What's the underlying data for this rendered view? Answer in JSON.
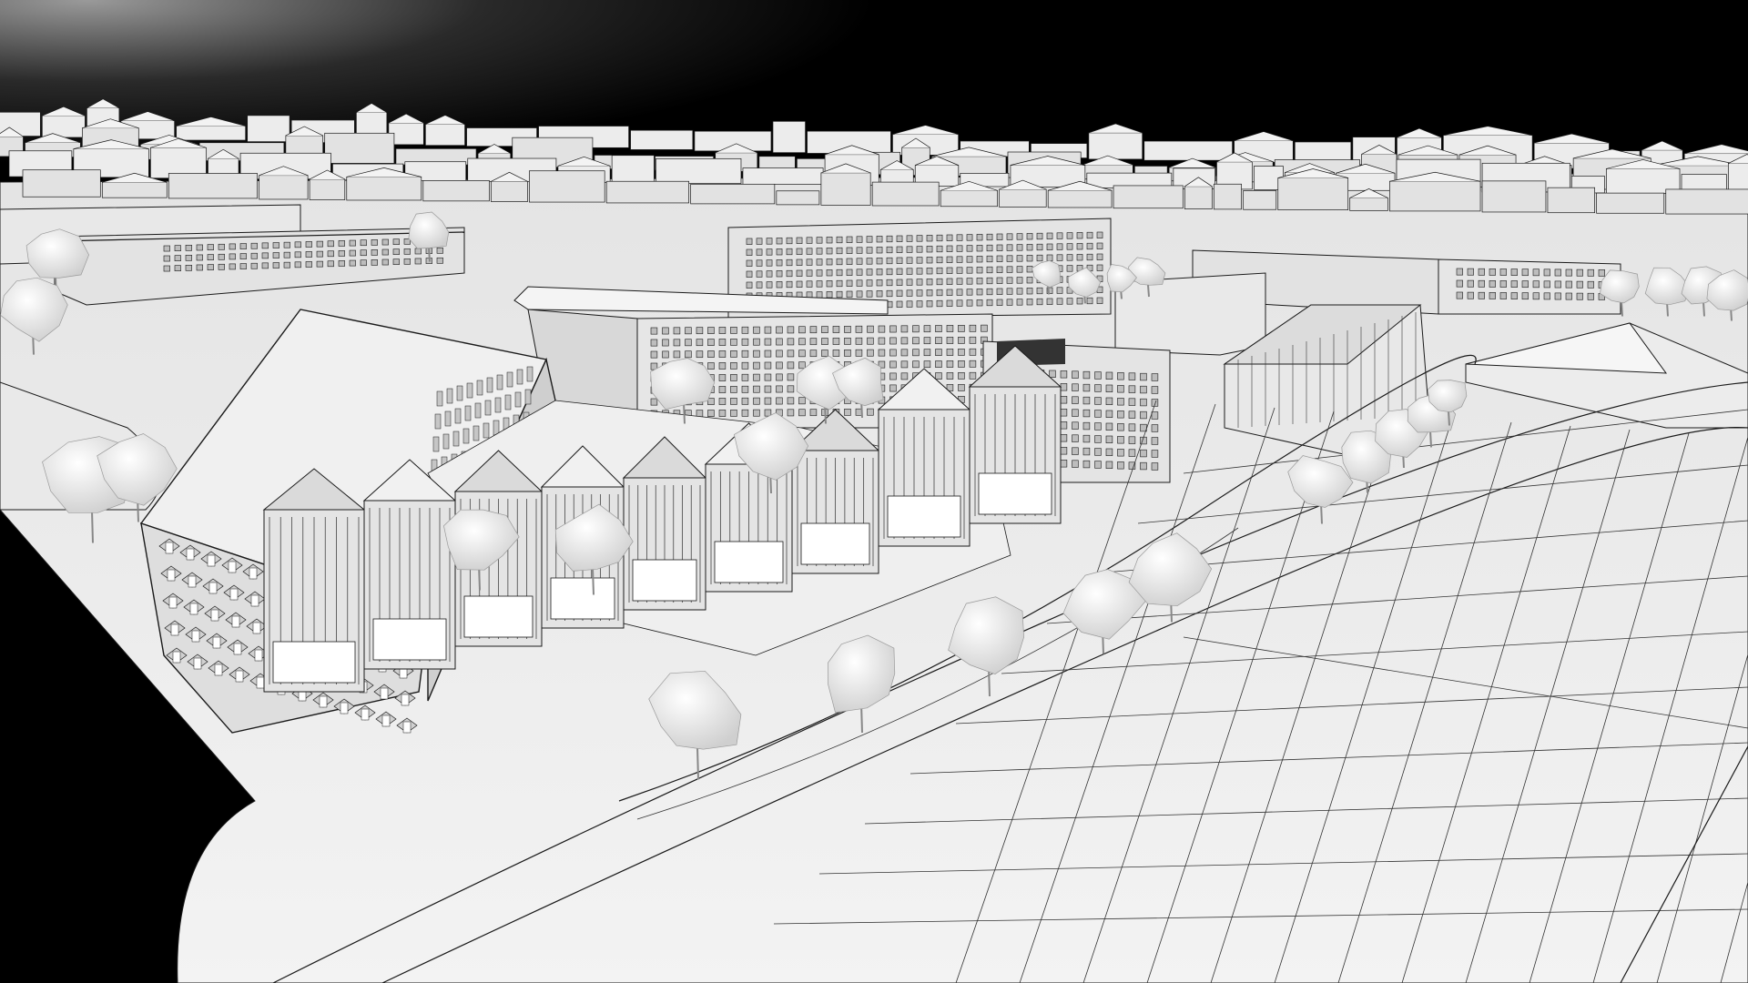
{
  "viewport": {
    "background_color": "#000000",
    "horizon_glow_color": "#8a8a8a",
    "ground_color": "#ededed",
    "building_color": "#e6e6e6",
    "roof_color": "#f4f4f4",
    "edge_color": "#1a1a1a",
    "tree_color": "#f6f6f6"
  },
  "scene": {
    "description_icon": "city-massing-model-icon",
    "render_style": "white clay with black outlines"
  }
}
